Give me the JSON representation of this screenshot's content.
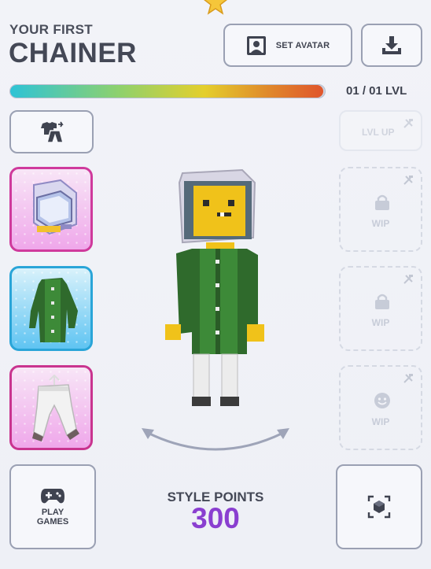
{
  "header": {
    "subtitle": "YOUR FIRST",
    "title": "CHAINER",
    "set_avatar_label": "SET AVATAR"
  },
  "progress": {
    "fill_fraction": 0.995,
    "level_text": "01 / 01 LVL"
  },
  "right_column": {
    "level_up_label": "LVL UP",
    "wip_slots": [
      {
        "label": "WIP",
        "icon": "bag-lock-icon"
      },
      {
        "label": "WIP",
        "icon": "bag-lock-icon"
      },
      {
        "label": "WIP",
        "icon": "smiley-icon"
      }
    ]
  },
  "left_column": {
    "slots": [
      {
        "item": "helmet",
        "icon": "space-helmet-icon",
        "accent": "#cf3a9c"
      },
      {
        "item": "green-coat",
        "icon": "coat-icon",
        "accent": "#2aa5d8"
      },
      {
        "item": "white-pants",
        "icon": "pants-icon",
        "accent": "#c9348f"
      }
    ]
  },
  "footer": {
    "play_label": "PLAY GAMES",
    "style_points_label": "STYLE POINTS",
    "style_points_value": "300"
  },
  "colors": {
    "accent_purple": "#8a3fd0",
    "text_dark": "#444856",
    "border": "#9aa0b3"
  }
}
